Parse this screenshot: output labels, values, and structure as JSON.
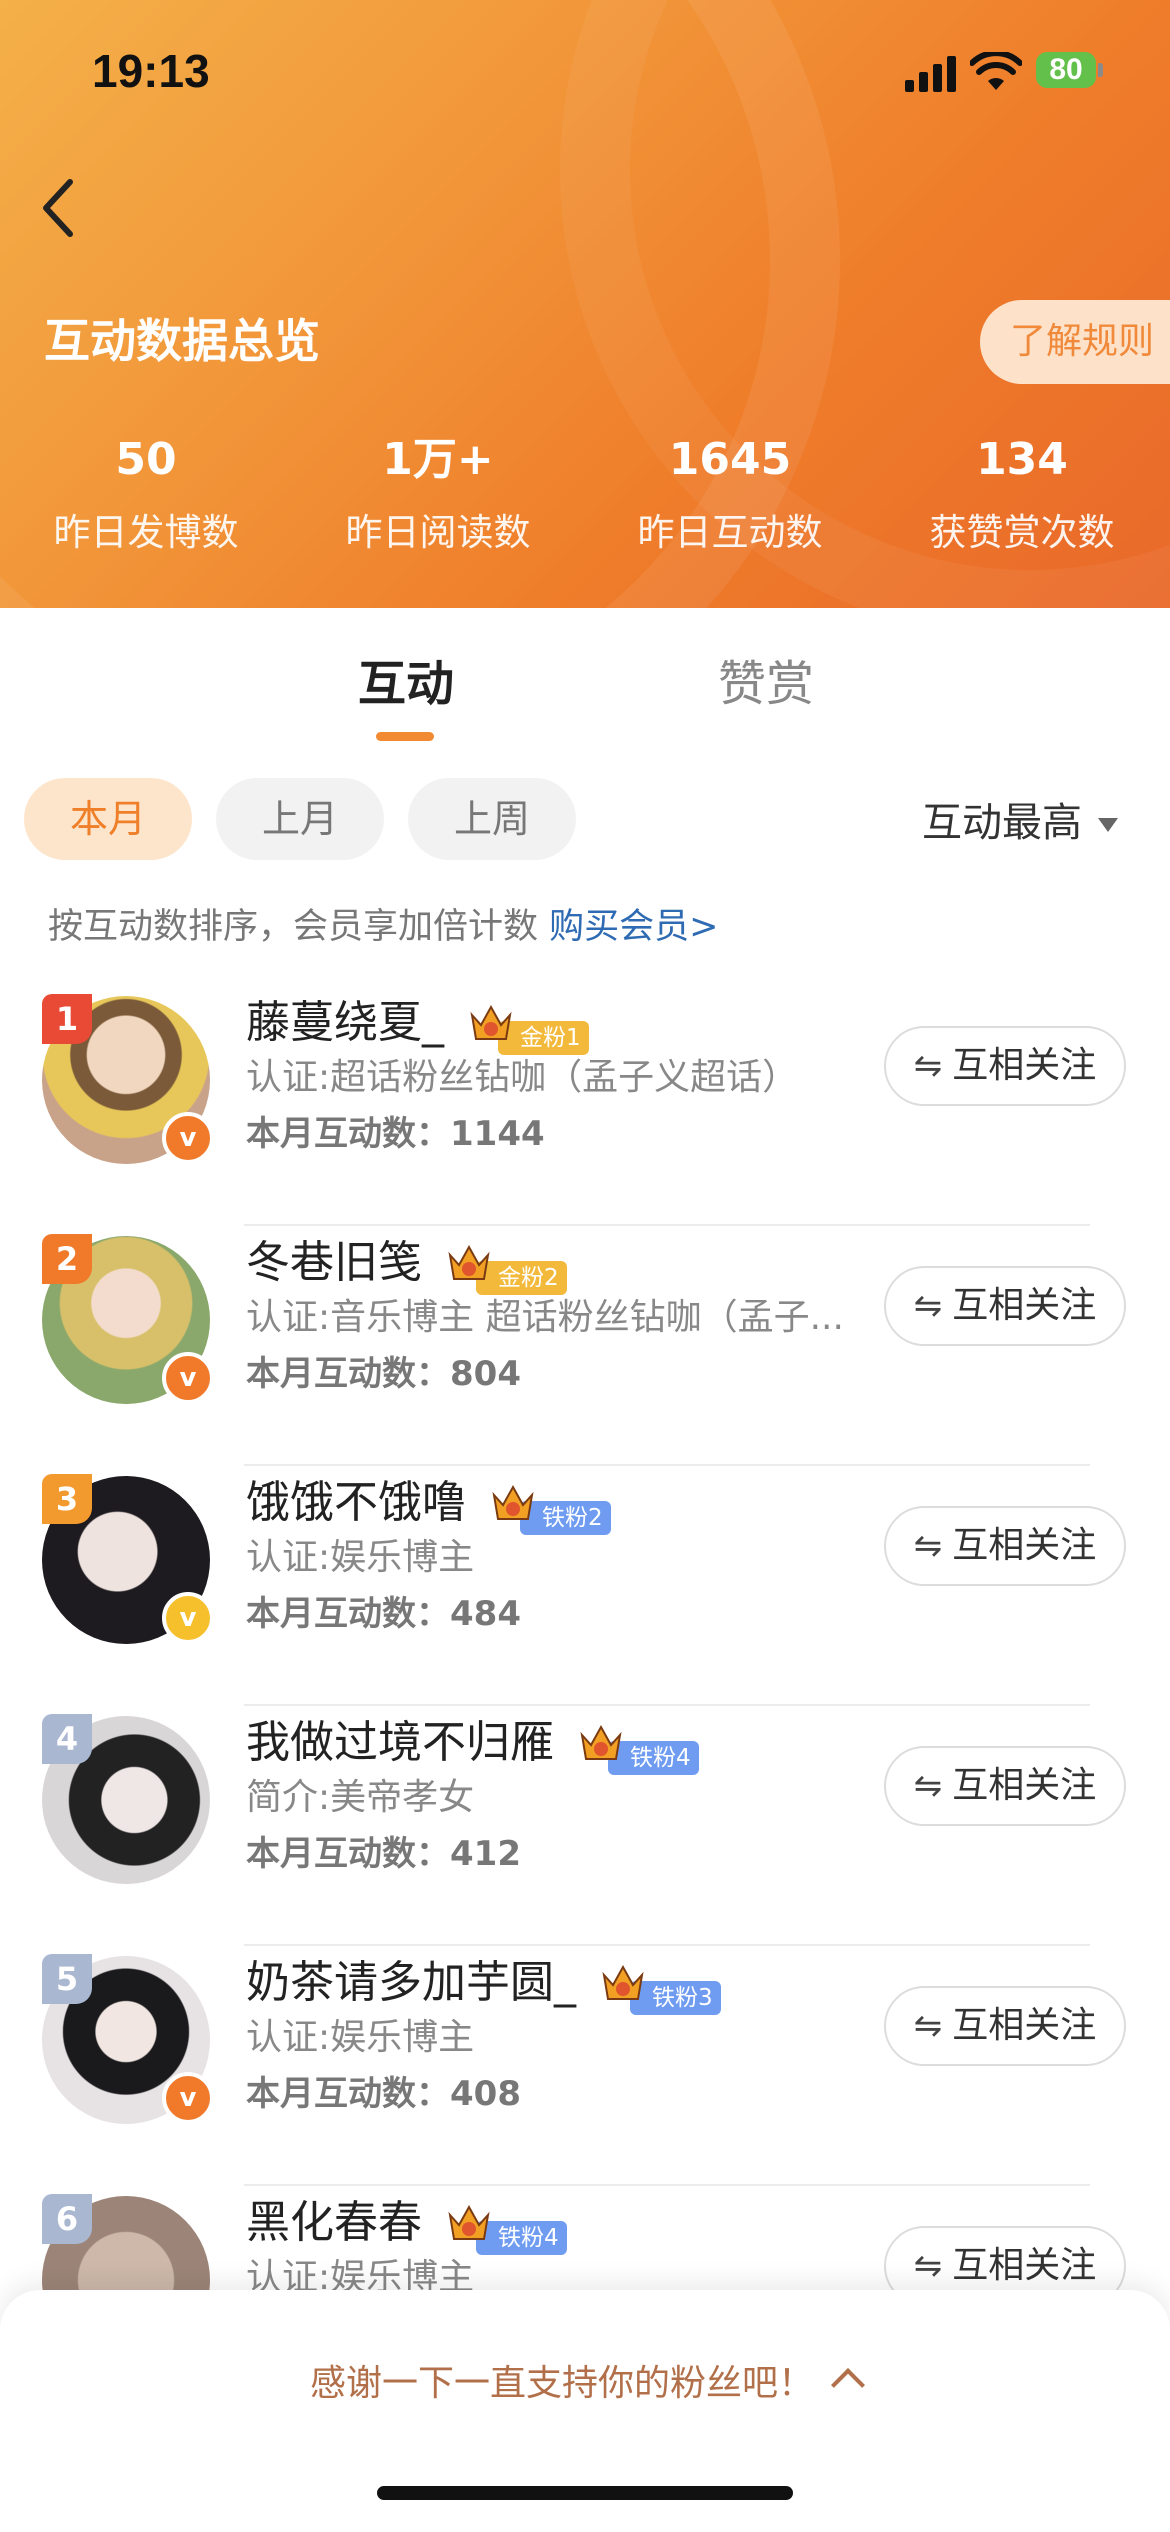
{
  "status_bar": {
    "time": "19:13",
    "battery": "80"
  },
  "header": {
    "title": "互动数据总览",
    "rules_button": "了解规则",
    "stats": [
      {
        "value": "50",
        "label": "昨日发博数"
      },
      {
        "value": "1万+",
        "label": "昨日阅读数"
      },
      {
        "value": "1645",
        "label": "昨日互动数"
      },
      {
        "value": "134",
        "label": "获赞赏次数"
      }
    ]
  },
  "tabs": {
    "active": "互动",
    "inactive": "赞赏"
  },
  "filters": {
    "this_month": "本月",
    "last_month": "上月",
    "last_week": "上周",
    "sort": "互动最高"
  },
  "hint": {
    "text": "按互动数排序，会员享加倍计数 ",
    "link": "购买会员>"
  },
  "follow_label": "互相关注",
  "fans": [
    {
      "rank": "1",
      "name": "藤蔓绕夏_",
      "badge": "金粉1",
      "badge_color": "#f3b93a",
      "sub": "认证:超话粉丝钻咖（孟子义超话）",
      "count": "本月互动数：1144",
      "v_color": "#f07a2a"
    },
    {
      "rank": "2",
      "name": "冬巷旧笺",
      "badge": "金粉2",
      "badge_color": "#f3b93a",
      "sub": "认证:音乐博主 超话粉丝钻咖（孟子...",
      "count": "本月互动数：804",
      "v_color": "#f07a2a"
    },
    {
      "rank": "3",
      "name": "饿饿不饿噜",
      "badge": "铁粉2",
      "badge_color": "#6f9cf0",
      "sub": "认证:娱乐博主",
      "count": "本月互动数：484",
      "v_color": "#f5c02c"
    },
    {
      "rank": "4",
      "name": "我做过境不归雁",
      "badge": "铁粉4",
      "badge_color": "#6f9cf0",
      "sub": "简介:美帝孝女",
      "count": "本月互动数：412",
      "v_color": ""
    },
    {
      "rank": "5",
      "name": "奶茶请多加芋圆_",
      "badge": "铁粉3",
      "badge_color": "#6f9cf0",
      "sub": "认证:娱乐博主",
      "count": "本月互动数：408",
      "v_color": "#f07a2a"
    },
    {
      "rank": "6",
      "name": "黑化春春",
      "badge": "铁粉4",
      "badge_color": "#6f9cf0",
      "sub": "认证:娱乐博主",
      "count": "",
      "v_color": ""
    }
  ],
  "bottom_bar": {
    "text": "感谢一下一直支持你的粉丝吧！"
  },
  "colors": {
    "accent": "#f28a33",
    "link": "#2f6bb3"
  }
}
